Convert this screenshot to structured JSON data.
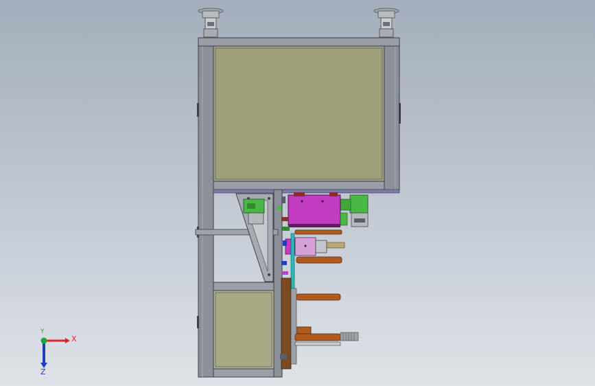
{
  "viewport": {
    "background_top": "#a4adbb",
    "background_bottom": "#dfe3e8"
  },
  "colors": {
    "frame": "#8b8f98",
    "frame_dark": "#5a5e66",
    "panel": "#9f9e7a",
    "panel_lower": "#aaa986",
    "purple_rail": "#7b7aa8",
    "magenta_block": "#c13cc1",
    "green_part": "#49b845",
    "brown_rod": "#b35a1f",
    "cyan_part": "#2fb6b5"
  },
  "triad": {
    "x_label": "X",
    "y_label": "Y",
    "z_label": "Z",
    "x_color": "#e0242a",
    "y_color": "#1fa33a",
    "z_color": "#1f3fb8",
    "icon": "coordinate-triad-icon"
  }
}
